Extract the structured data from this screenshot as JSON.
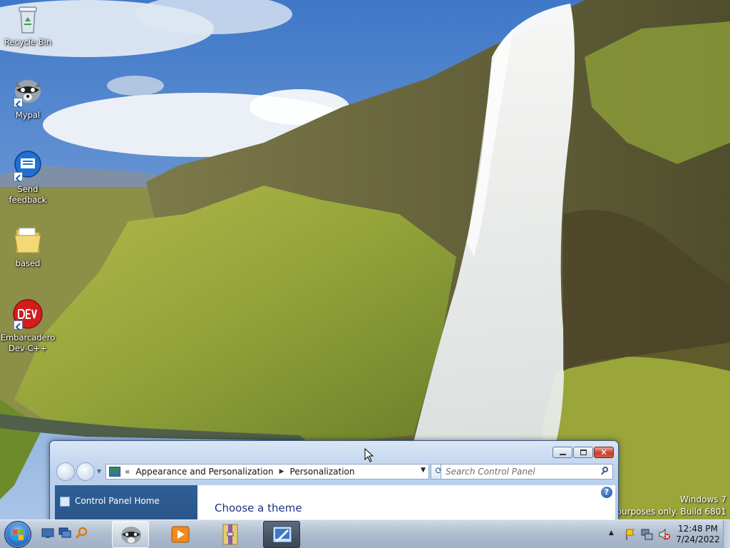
{
  "desktop": {
    "icons": [
      {
        "label_line1": "Recycle Bin",
        "label_line2": "",
        "icon": "recycle-bin-icon"
      },
      {
        "label_line1": "Mypal",
        "label_line2": "",
        "icon": "mypal-raccoon-icon"
      },
      {
        "label_line1": "Send",
        "label_line2": "feedback",
        "icon": "feedback-chat-icon"
      },
      {
        "label_line1": "based",
        "label_line2": "",
        "icon": "folder-icon"
      },
      {
        "label_line1": "Embarcadero",
        "label_line2": "Dev-C++",
        "icon": "devcpp-icon"
      }
    ],
    "watermark": {
      "line1": "Windows 7",
      "line2": "ng purposes only. Build 6801"
    }
  },
  "window": {
    "title": "",
    "address": {
      "overflow": "«",
      "crumb1": "Appearance and Personalization",
      "crumb2": "Personalization"
    },
    "search_placeholder": "Search Control Panel",
    "left_pane": {
      "home_link": "Control Panel Home"
    },
    "main": {
      "heading": "Choose a theme"
    },
    "help": "?"
  },
  "taskbar": {
    "quick_launch": [
      "show-desktop-icon",
      "switch-windows-icon",
      "search-icon"
    ],
    "buttons": [
      "mypal-raccoon-icon",
      "media-player-icon",
      "archive-icon",
      "control-panel-icon"
    ],
    "clock": {
      "time": "12:48 PM",
      "date": "7/24/2022"
    },
    "tray_icons": [
      "show-hidden-icons-arrow",
      "action-center-flag-icon",
      "network-icon",
      "volume-muted-icon"
    ]
  },
  "colors": {
    "sky": "#6a97d6",
    "grass": "#93a43a",
    "cliff": "#6f6a3c",
    "window_border": "#3a5b8c",
    "left_pane": "#2f5f96",
    "heading": "#1e3287"
  }
}
